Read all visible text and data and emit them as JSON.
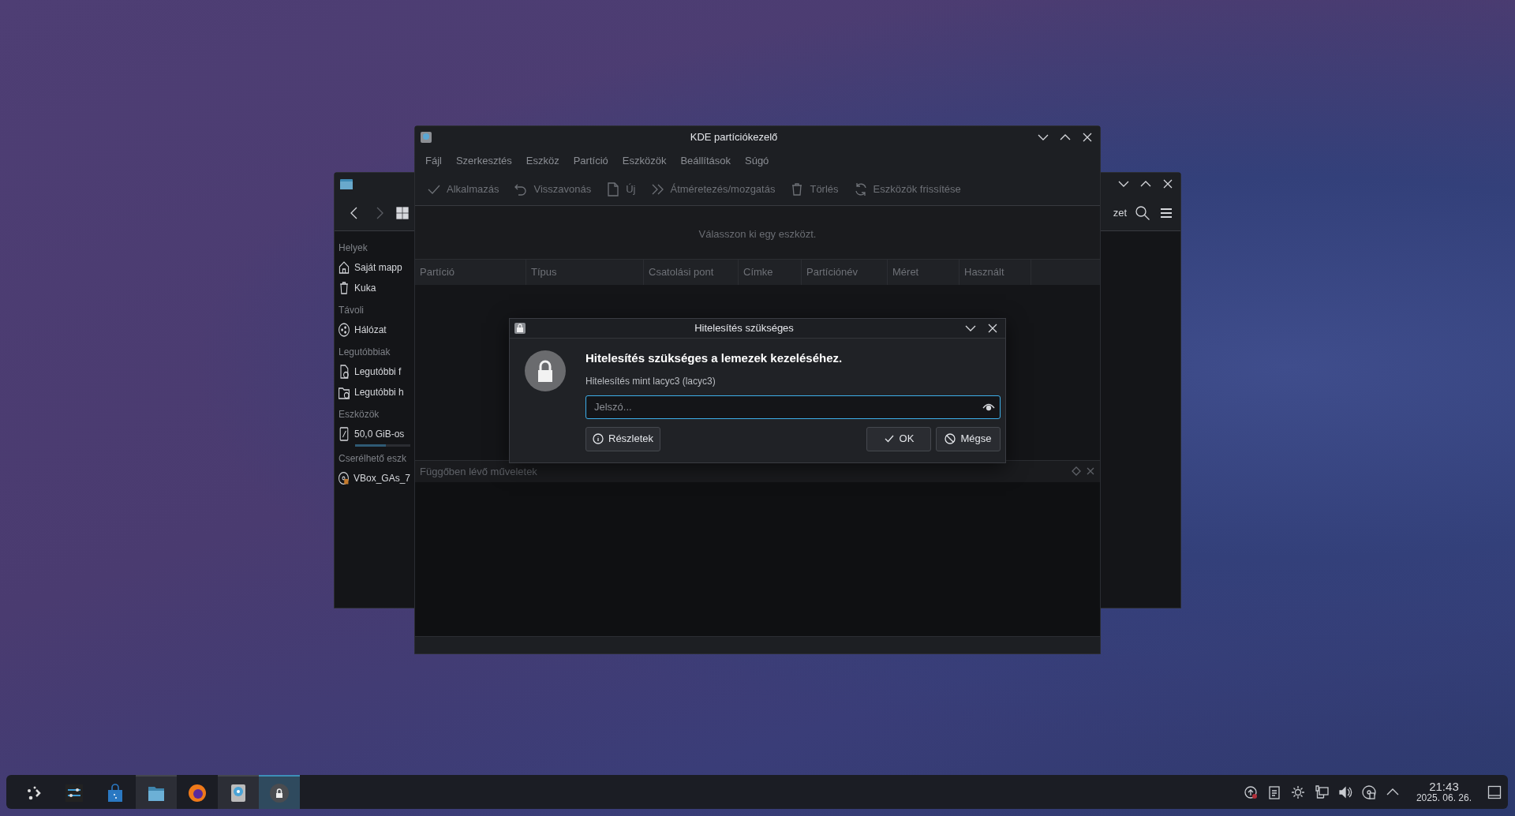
{
  "dolphin_window": {
    "toolbar_partial_label": "zet",
    "sidebar": [
      {
        "heading": "Helyek",
        "items": [
          {
            "label": "Saját mapp"
          },
          {
            "label": "Kuka"
          }
        ]
      },
      {
        "heading": "Távoli",
        "items": [
          {
            "label": "Hálózat"
          }
        ]
      },
      {
        "heading": "Legutóbbiak",
        "items": [
          {
            "label": "Legutóbbi f"
          },
          {
            "label": "Legutóbbi h"
          }
        ]
      },
      {
        "heading": "Eszközök",
        "items": [
          {
            "label": "50,0 GiB-os",
            "level": 0.55
          }
        ]
      },
      {
        "heading": "Cserélhető eszk",
        "items": [
          {
            "label": "VBox_GAs_7"
          }
        ]
      }
    ]
  },
  "partition_window": {
    "title": "KDE partíciókezelő",
    "menu": [
      "Fájl",
      "Szerkesztés",
      "Eszköz",
      "Partíció",
      "Eszközök",
      "Beállítások",
      "Súgó"
    ],
    "toolbar": [
      {
        "label": "Alkalmazás",
        "disabled": true
      },
      {
        "label": "Visszavonás",
        "disabled": true
      },
      {
        "label": "Új",
        "disabled": true
      },
      {
        "label": "Átméretezés/mozgatás",
        "disabled": true
      },
      {
        "label": "Törlés",
        "disabled": true
      },
      {
        "label": "Eszközök frissítése",
        "disabled": true
      }
    ],
    "message": "Válasszon ki egy eszközt.",
    "table": {
      "columns": [
        "Partíció",
        "Típus",
        "Csatolási pont",
        "Címke",
        "Partíciónév",
        "Méret",
        "Használt"
      ]
    },
    "pending_panel": {
      "title": "Függőben lévő műveletek"
    }
  },
  "auth_dialog": {
    "title": "Hitelesítés szükséges",
    "heading": "Hitelesítés szükséges a lemezek kezeléséhez.",
    "subtitle": "Hitelesítés mint lacyc3 (lacyc3)",
    "password": {
      "placeholder": "Jelszó..."
    },
    "buttons": [
      {
        "kind": "details",
        "label": "Részletek"
      },
      {
        "kind": "ok",
        "label": "OK"
      },
      {
        "kind": "cancel",
        "label": "Mégse"
      }
    ]
  },
  "taskbar": {
    "items": [
      {
        "kind": "launcher",
        "open": false,
        "active": false
      },
      {
        "kind": "settings",
        "open": false,
        "active": false
      },
      {
        "kind": "store",
        "open": false,
        "active": false
      },
      {
        "kind": "files",
        "open": true,
        "active": false
      },
      {
        "kind": "browser",
        "open": false,
        "active": false
      },
      {
        "kind": "disk",
        "open": true,
        "active": false
      },
      {
        "kind": "lock",
        "open": true,
        "active": true
      }
    ],
    "clock": {
      "time": "21:43",
      "date": "2025. 06. 26."
    }
  }
}
